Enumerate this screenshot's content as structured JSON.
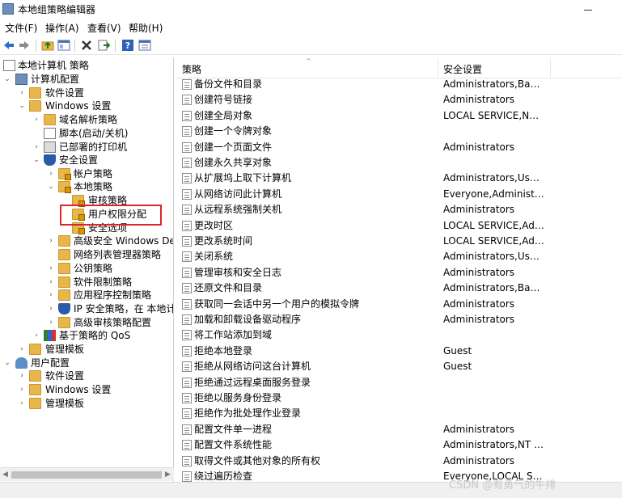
{
  "window": {
    "title": "本地组策略编辑器"
  },
  "menu": [
    "文件(F)",
    "操作(A)",
    "查看(V)",
    "帮助(H)"
  ],
  "toolbar": {
    "icons": [
      "back-arrow-icon",
      "forward-arrow-icon",
      "up-folder-icon",
      "show-tree-icon",
      "delete-icon",
      "export-icon",
      "help-icon",
      "properties-icon"
    ]
  },
  "tree": {
    "root": "本地计算机 策略",
    "computer_config": "计算机配置",
    "software_settings": "软件设置",
    "windows_settings": "Windows 设置",
    "dns": "域名解析策略",
    "scripts": "脚本(启动/关机)",
    "printers": "已部署的打印机",
    "security_settings": "安全设置",
    "account_policies": "帐户策略",
    "local_policies": "本地策略",
    "audit_policy": "审核策略",
    "user_rights": "用户权限分配",
    "security_options": "安全选项",
    "firewall": "高级安全 Windows Defe",
    "network_list": "网络列表管理器策略",
    "public_key": "公钥策略",
    "software_restriction": "软件限制策略",
    "app_control": "应用程序控制策略",
    "ip_security": "IP 安全策略，在 本地计算",
    "advanced_audit": "高级审核策略配置",
    "qos": "基于策略的 QoS",
    "admin_templates": "管理模板",
    "user_config": "用户配置",
    "u_software": "软件设置",
    "u_windows": "Windows 设置",
    "u_admin": "管理模板"
  },
  "list": {
    "col_policy": "策略",
    "col_setting": "安全设置",
    "rows": [
      {
        "policy": "备份文件和目录",
        "setting": "Administrators,Backup ..."
      },
      {
        "policy": "创建符号链接",
        "setting": "Administrators"
      },
      {
        "policy": "创建全局对象",
        "setting": "LOCAL SERVICE,NETW..."
      },
      {
        "policy": "创建一个令牌对象",
        "setting": ""
      },
      {
        "policy": "创建一个页面文件",
        "setting": "Administrators"
      },
      {
        "policy": "创建永久共享对象",
        "setting": ""
      },
      {
        "policy": "从扩展坞上取下计算机",
        "setting": "Administrators,Users"
      },
      {
        "policy": "从网络访问此计算机",
        "setting": "Everyone,Administrator..."
      },
      {
        "policy": "从远程系统强制关机",
        "setting": "Administrators"
      },
      {
        "policy": "更改时区",
        "setting": "LOCAL SERVICE,Admini..."
      },
      {
        "policy": "更改系统时间",
        "setting": "LOCAL SERVICE,Admini..."
      },
      {
        "policy": "关闭系统",
        "setting": "Administrators,Users,Ba..."
      },
      {
        "policy": "管理审核和安全日志",
        "setting": "Administrators"
      },
      {
        "policy": "还原文件和目录",
        "setting": "Administrators,Backup ..."
      },
      {
        "policy": "获取同一会话中另一个用户的模拟令牌",
        "setting": "Administrators"
      },
      {
        "policy": "加载和卸载设备驱动程序",
        "setting": "Administrators"
      },
      {
        "policy": "将工作站添加到域",
        "setting": ""
      },
      {
        "policy": "拒绝本地登录",
        "setting": "Guest"
      },
      {
        "policy": "拒绝从网络访问这台计算机",
        "setting": "Guest"
      },
      {
        "policy": "拒绝通过远程桌面服务登录",
        "setting": ""
      },
      {
        "policy": "拒绝以服务身份登录",
        "setting": ""
      },
      {
        "policy": "拒绝作为批处理作业登录",
        "setting": ""
      },
      {
        "policy": "配置文件单一进程",
        "setting": "Administrators"
      },
      {
        "policy": "配置文件系统性能",
        "setting": "Administrators,NT SER..."
      },
      {
        "policy": "取得文件或其他对象的所有权",
        "setting": "Administrators"
      },
      {
        "policy": "绕过遍历检查",
        "setting": "Everyone,LOCAL SERVI..."
      }
    ]
  },
  "watermark": "CSDN @有勇气的牛排"
}
